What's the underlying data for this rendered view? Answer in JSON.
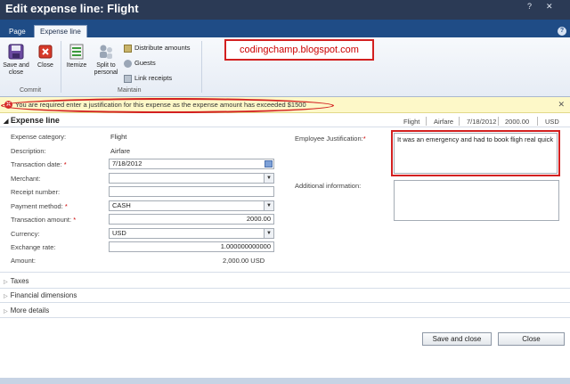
{
  "window": {
    "title": "Edit expense line: Flight",
    "help_label": "?",
    "close_label": "✕"
  },
  "tabs": [
    {
      "label": "Page"
    },
    {
      "label": "Expense line"
    }
  ],
  "ribbon": {
    "commit_group_label": "Commit",
    "maintain_group_label": "Maintain",
    "save_close_label_1": "Save and",
    "save_close_label_2": "close",
    "close_label": "Close",
    "itemize_label": "Itemize",
    "split_label_1": "Split to",
    "split_label_2": "personal",
    "distribute_label": "Distribute amounts",
    "guests_label": "Guests",
    "link_receipts_label": "Link receipts"
  },
  "overlay_text": "codingchamp.blogspot.com",
  "warning": {
    "text": "You are required enter a justification for this expense as the expense amount has exceeded $1500",
    "close_label": "✕"
  },
  "section": {
    "title": "Expense line",
    "summary": [
      "Flight",
      "Airfare",
      "7/18/2012",
      "2000.00",
      "USD"
    ]
  },
  "fields": {
    "expense_category": {
      "label": "Expense category:",
      "value": "Flight"
    },
    "description": {
      "label": "Description:",
      "value": "Airfare"
    },
    "transaction_date": {
      "label": "Transaction date:",
      "value": "7/18/2012"
    },
    "merchant": {
      "label": "Merchant:",
      "value": ""
    },
    "receipt_number": {
      "label": "Receipt number:",
      "value": ""
    },
    "payment_method": {
      "label": "Payment method:",
      "value": "CASH"
    },
    "transaction_amount": {
      "label": "Transaction amount:",
      "value": "2000.00"
    },
    "currency": {
      "label": "Currency:",
      "value": "USD"
    },
    "exchange_rate": {
      "label": "Exchange rate:",
      "value": "1.000000000000"
    },
    "amount": {
      "label": "Amount:",
      "value": "2,000.00 USD"
    },
    "employee_justification": {
      "label": "Employee Justification:",
      "value": "It was an emergency and had to book fligh real quick"
    },
    "additional_information": {
      "label": "Additional information:",
      "value": ""
    }
  },
  "required_mark": "*",
  "collapsed_sections": [
    {
      "label": "Taxes"
    },
    {
      "label": "Financial dimensions"
    },
    {
      "label": "More details"
    }
  ],
  "footer": {
    "save_close_label": "Save and close",
    "close_label": "Close"
  },
  "colors": {
    "titlebar": "#2b3a55",
    "tabs": "#1f4c86",
    "warning_bg": "#fdf8c8",
    "highlight": "#d32020"
  }
}
